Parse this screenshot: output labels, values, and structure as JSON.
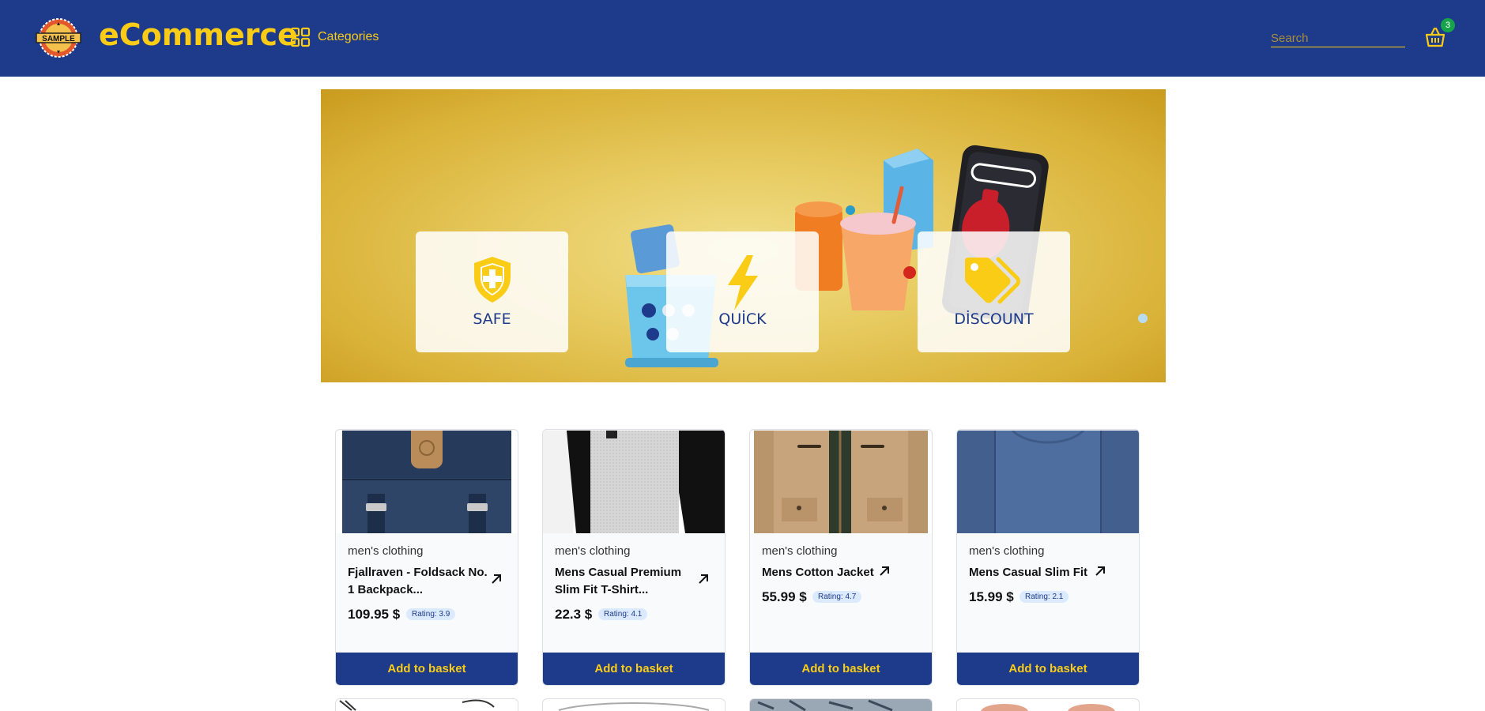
{
  "header": {
    "brand": "eCommerce",
    "logo_text": "SAMPLE",
    "categories_label": "Categories",
    "search_placeholder": "Search",
    "basket_count": "3",
    "colors": {
      "bg": "#1e3a8a",
      "accent": "#facc15"
    }
  },
  "banner": {
    "features": [
      {
        "label": "SAFE",
        "icon": "shield-plus-icon"
      },
      {
        "label": "QUİCK",
        "icon": "lightning-icon"
      },
      {
        "label": "DİSCOUNT",
        "icon": "price-tag-icon"
      }
    ]
  },
  "products": [
    {
      "category": "men's clothing",
      "title": "Fjallraven - Foldsack No. 1 Backpack...",
      "price": "109.95 $",
      "rating": "Rating: 3.9",
      "button": "Add to basket",
      "image": "navy-backpack"
    },
    {
      "category": "men's clothing",
      "title": "Mens Casual Premium Slim Fit T-Shirt...",
      "price": "22.3 $",
      "rating": "Rating: 4.1",
      "button": "Add to basket",
      "image": "raglan-tshirt"
    },
    {
      "category": "men's clothing",
      "title": "Mens Cotton Jacket",
      "price": "55.99 $",
      "rating": "Rating: 4.7",
      "button": "Add to basket",
      "image": "tan-jacket"
    },
    {
      "category": "men's clothing",
      "title": "Mens Casual Slim Fit",
      "price": "15.99 $",
      "rating": "Rating: 2.1",
      "button": "Add to basket",
      "image": "blue-longsleeve"
    }
  ]
}
